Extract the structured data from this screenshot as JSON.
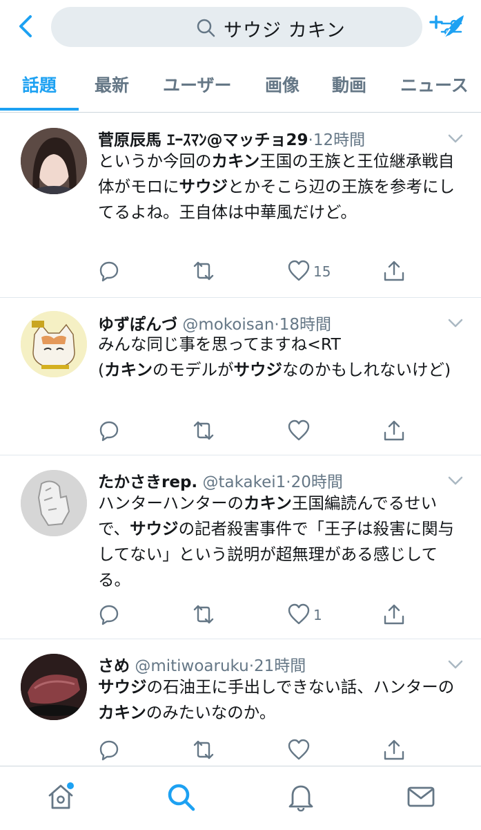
{
  "search": {
    "query": "サウジ カキン"
  },
  "tabs": [
    "話題",
    "最新",
    "ユーザー",
    "画像",
    "動画",
    "ニュース"
  ],
  "colors": {
    "accent": "#1da1f2",
    "muted": "#657786",
    "text": "#14171a"
  },
  "tweets": [
    {
      "name": "菅原辰馬 ｴｰｽﾏﾝ@マッチョ29",
      "handle": "",
      "time": "·12時間",
      "body": [
        {
          "t": "というか今回の",
          "b": false
        },
        {
          "t": "カキン",
          "b": true
        },
        {
          "t": "王国の王族と王位継承戦自体がモロに",
          "b": false
        },
        {
          "t": "サウジ",
          "b": true
        },
        {
          "t": "とかそこら辺の王族を参考にしてるよね。王自体は中華風だけど。",
          "b": false
        }
      ],
      "likes": "15"
    },
    {
      "name": "ゆずぽんづ",
      "handle": "@mokoisan",
      "time": "·18時間",
      "body": [
        {
          "t": "みんな同じ事を思ってますね<RT\n(",
          "b": false
        },
        {
          "t": "カキン",
          "b": true
        },
        {
          "t": "のモデルが",
          "b": false
        },
        {
          "t": "サウジ",
          "b": true
        },
        {
          "t": "なのかもしれないけど)",
          "b": false
        }
      ],
      "likes": ""
    },
    {
      "name": "たかさきrep.",
      "handle": "@takakei1",
      "time": "·20時間",
      "body": [
        {
          "t": "ハンターハンターの",
          "b": false
        },
        {
          "t": "カキン",
          "b": true
        },
        {
          "t": "王国編読んでるせいで、",
          "b": false
        },
        {
          "t": "サウジ",
          "b": true
        },
        {
          "t": "の記者殺害事件で「王子は殺害に関与してない」という説明が超無理がある感じしてる。",
          "b": false
        }
      ],
      "likes": "1"
    },
    {
      "name": "さめ",
      "handle": "@mitiwoaruku",
      "time": "·21時間",
      "body": [
        {
          "t": "サウジ",
          "b": true
        },
        {
          "t": "の石油王に手出しできない話、ハンターの",
          "b": false
        },
        {
          "t": "カキン",
          "b": true
        },
        {
          "t": "のみたいなのか。",
          "b": false
        }
      ],
      "likes": ""
    }
  ],
  "icons": {
    "header": [
      "back-chevron-icon",
      "search-icon",
      "filter-icon",
      "compose-tweet-icon"
    ],
    "actions": [
      "reply-icon",
      "retweet-icon",
      "like-icon",
      "share-icon"
    ],
    "nav": [
      "home-icon",
      "search-icon",
      "notifications-icon",
      "messages-icon"
    ]
  }
}
